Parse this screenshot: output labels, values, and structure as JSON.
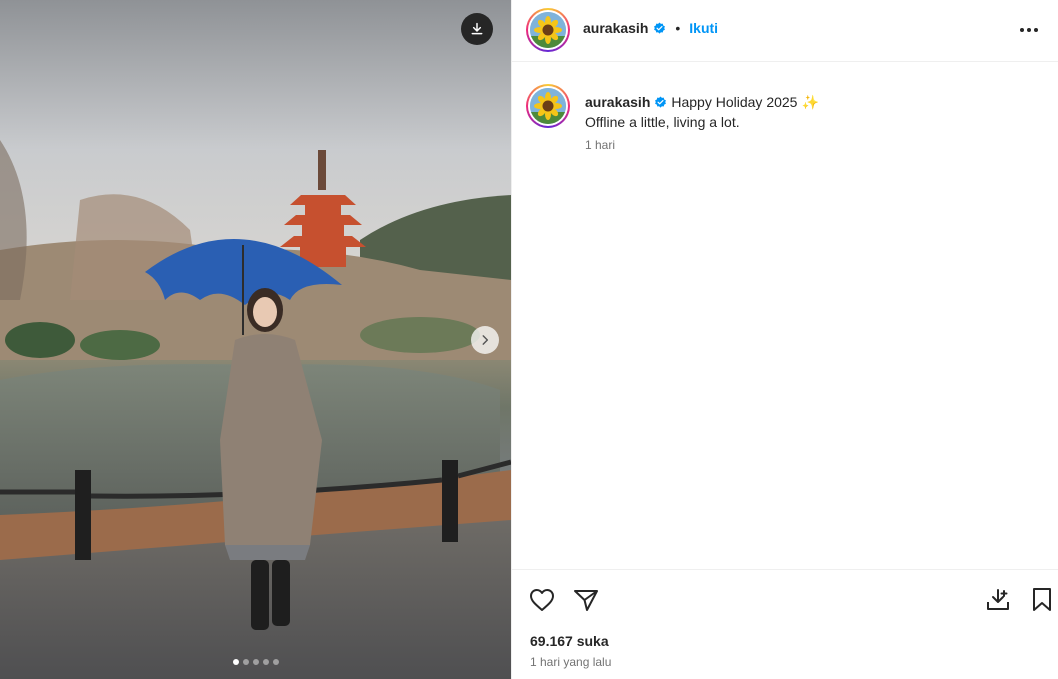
{
  "post": {
    "carousel": {
      "slide_count": 5,
      "active_slide": 1
    },
    "icons": {
      "download": "download-icon",
      "next": "chevron-right-icon",
      "more": "more-horizontal-icon",
      "like": "heart-icon",
      "share": "send-icon",
      "save_download": "download-tray-icon",
      "bookmark": "bookmark-icon",
      "verified": "verified-badge-icon"
    }
  },
  "header": {
    "username": "aurakasih",
    "separator": "•",
    "follow_label": "Ikuti"
  },
  "caption": {
    "username": "aurakasih",
    "line1": "Happy Holiday 2025",
    "emoji": "✨",
    "line2": "Offline a little, living a lot.",
    "time": "1 hari"
  },
  "footer": {
    "likes": "69.167 suka",
    "posted": "1 hari yang lalu"
  },
  "colors": {
    "accent": "#0095f6",
    "verified": "#0095f6",
    "text": "#262626",
    "muted": "#737373",
    "umbrella": "#2a5fb3"
  }
}
